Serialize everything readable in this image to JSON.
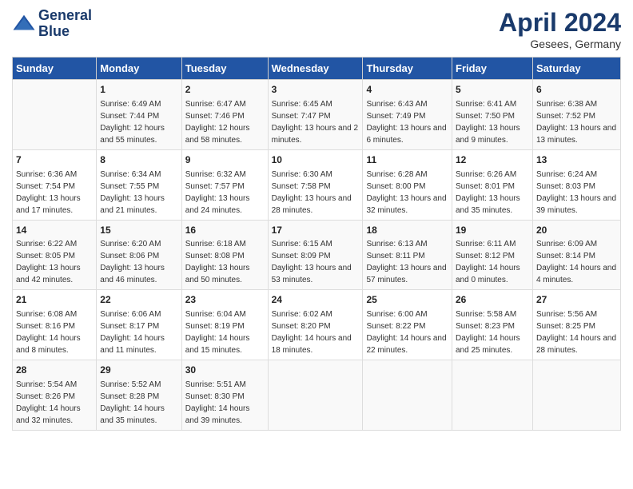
{
  "header": {
    "logo_line1": "General",
    "logo_line2": "Blue",
    "title": "April 2024",
    "subtitle": "Gesees, Germany"
  },
  "days_of_week": [
    "Sunday",
    "Monday",
    "Tuesday",
    "Wednesday",
    "Thursday",
    "Friday",
    "Saturday"
  ],
  "weeks": [
    [
      {
        "num": "",
        "sunrise": "",
        "sunset": "",
        "daylight": ""
      },
      {
        "num": "1",
        "sunrise": "Sunrise: 6:49 AM",
        "sunset": "Sunset: 7:44 PM",
        "daylight": "Daylight: 12 hours and 55 minutes."
      },
      {
        "num": "2",
        "sunrise": "Sunrise: 6:47 AM",
        "sunset": "Sunset: 7:46 PM",
        "daylight": "Daylight: 12 hours and 58 minutes."
      },
      {
        "num": "3",
        "sunrise": "Sunrise: 6:45 AM",
        "sunset": "Sunset: 7:47 PM",
        "daylight": "Daylight: 13 hours and 2 minutes."
      },
      {
        "num": "4",
        "sunrise": "Sunrise: 6:43 AM",
        "sunset": "Sunset: 7:49 PM",
        "daylight": "Daylight: 13 hours and 6 minutes."
      },
      {
        "num": "5",
        "sunrise": "Sunrise: 6:41 AM",
        "sunset": "Sunset: 7:50 PM",
        "daylight": "Daylight: 13 hours and 9 minutes."
      },
      {
        "num": "6",
        "sunrise": "Sunrise: 6:38 AM",
        "sunset": "Sunset: 7:52 PM",
        "daylight": "Daylight: 13 hours and 13 minutes."
      }
    ],
    [
      {
        "num": "7",
        "sunrise": "Sunrise: 6:36 AM",
        "sunset": "Sunset: 7:54 PM",
        "daylight": "Daylight: 13 hours and 17 minutes."
      },
      {
        "num": "8",
        "sunrise": "Sunrise: 6:34 AM",
        "sunset": "Sunset: 7:55 PM",
        "daylight": "Daylight: 13 hours and 21 minutes."
      },
      {
        "num": "9",
        "sunrise": "Sunrise: 6:32 AM",
        "sunset": "Sunset: 7:57 PM",
        "daylight": "Daylight: 13 hours and 24 minutes."
      },
      {
        "num": "10",
        "sunrise": "Sunrise: 6:30 AM",
        "sunset": "Sunset: 7:58 PM",
        "daylight": "Daylight: 13 hours and 28 minutes."
      },
      {
        "num": "11",
        "sunrise": "Sunrise: 6:28 AM",
        "sunset": "Sunset: 8:00 PM",
        "daylight": "Daylight: 13 hours and 32 minutes."
      },
      {
        "num": "12",
        "sunrise": "Sunrise: 6:26 AM",
        "sunset": "Sunset: 8:01 PM",
        "daylight": "Daylight: 13 hours and 35 minutes."
      },
      {
        "num": "13",
        "sunrise": "Sunrise: 6:24 AM",
        "sunset": "Sunset: 8:03 PM",
        "daylight": "Daylight: 13 hours and 39 minutes."
      }
    ],
    [
      {
        "num": "14",
        "sunrise": "Sunrise: 6:22 AM",
        "sunset": "Sunset: 8:05 PM",
        "daylight": "Daylight: 13 hours and 42 minutes."
      },
      {
        "num": "15",
        "sunrise": "Sunrise: 6:20 AM",
        "sunset": "Sunset: 8:06 PM",
        "daylight": "Daylight: 13 hours and 46 minutes."
      },
      {
        "num": "16",
        "sunrise": "Sunrise: 6:18 AM",
        "sunset": "Sunset: 8:08 PM",
        "daylight": "Daylight: 13 hours and 50 minutes."
      },
      {
        "num": "17",
        "sunrise": "Sunrise: 6:15 AM",
        "sunset": "Sunset: 8:09 PM",
        "daylight": "Daylight: 13 hours and 53 minutes."
      },
      {
        "num": "18",
        "sunrise": "Sunrise: 6:13 AM",
        "sunset": "Sunset: 8:11 PM",
        "daylight": "Daylight: 13 hours and 57 minutes."
      },
      {
        "num": "19",
        "sunrise": "Sunrise: 6:11 AM",
        "sunset": "Sunset: 8:12 PM",
        "daylight": "Daylight: 14 hours and 0 minutes."
      },
      {
        "num": "20",
        "sunrise": "Sunrise: 6:09 AM",
        "sunset": "Sunset: 8:14 PM",
        "daylight": "Daylight: 14 hours and 4 minutes."
      }
    ],
    [
      {
        "num": "21",
        "sunrise": "Sunrise: 6:08 AM",
        "sunset": "Sunset: 8:16 PM",
        "daylight": "Daylight: 14 hours and 8 minutes."
      },
      {
        "num": "22",
        "sunrise": "Sunrise: 6:06 AM",
        "sunset": "Sunset: 8:17 PM",
        "daylight": "Daylight: 14 hours and 11 minutes."
      },
      {
        "num": "23",
        "sunrise": "Sunrise: 6:04 AM",
        "sunset": "Sunset: 8:19 PM",
        "daylight": "Daylight: 14 hours and 15 minutes."
      },
      {
        "num": "24",
        "sunrise": "Sunrise: 6:02 AM",
        "sunset": "Sunset: 8:20 PM",
        "daylight": "Daylight: 14 hours and 18 minutes."
      },
      {
        "num": "25",
        "sunrise": "Sunrise: 6:00 AM",
        "sunset": "Sunset: 8:22 PM",
        "daylight": "Daylight: 14 hours and 22 minutes."
      },
      {
        "num": "26",
        "sunrise": "Sunrise: 5:58 AM",
        "sunset": "Sunset: 8:23 PM",
        "daylight": "Daylight: 14 hours and 25 minutes."
      },
      {
        "num": "27",
        "sunrise": "Sunrise: 5:56 AM",
        "sunset": "Sunset: 8:25 PM",
        "daylight": "Daylight: 14 hours and 28 minutes."
      }
    ],
    [
      {
        "num": "28",
        "sunrise": "Sunrise: 5:54 AM",
        "sunset": "Sunset: 8:26 PM",
        "daylight": "Daylight: 14 hours and 32 minutes."
      },
      {
        "num": "29",
        "sunrise": "Sunrise: 5:52 AM",
        "sunset": "Sunset: 8:28 PM",
        "daylight": "Daylight: 14 hours and 35 minutes."
      },
      {
        "num": "30",
        "sunrise": "Sunrise: 5:51 AM",
        "sunset": "Sunset: 8:30 PM",
        "daylight": "Daylight: 14 hours and 39 minutes."
      },
      {
        "num": "",
        "sunrise": "",
        "sunset": "",
        "daylight": ""
      },
      {
        "num": "",
        "sunrise": "",
        "sunset": "",
        "daylight": ""
      },
      {
        "num": "",
        "sunrise": "",
        "sunset": "",
        "daylight": ""
      },
      {
        "num": "",
        "sunrise": "",
        "sunset": "",
        "daylight": ""
      }
    ]
  ]
}
